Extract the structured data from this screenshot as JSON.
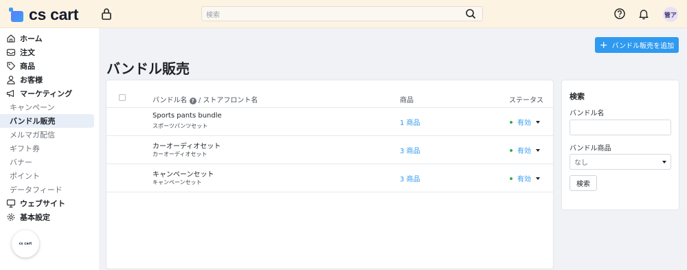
{
  "header": {
    "logo_text": "cs cart",
    "search_placeholder": "検索",
    "avatar_text": "管ア"
  },
  "sidebar": {
    "items": [
      {
        "label": "ホーム",
        "icon": "home-icon",
        "level": "top"
      },
      {
        "label": "注文",
        "icon": "inbox-icon",
        "level": "top"
      },
      {
        "label": "商品",
        "icon": "tag-icon",
        "level": "top"
      },
      {
        "label": "お客様",
        "icon": "user-icon",
        "level": "top"
      },
      {
        "label": "マーケティング",
        "icon": "megaphone-icon",
        "level": "top"
      },
      {
        "label": "キャンペーン",
        "level": "sub"
      },
      {
        "label": "バンドル販売",
        "level": "sub",
        "active": true
      },
      {
        "label": "メルマガ配信",
        "level": "sub"
      },
      {
        "label": "ギフト券",
        "level": "sub"
      },
      {
        "label": "バナー",
        "level": "sub"
      },
      {
        "label": "ポイント",
        "level": "sub"
      },
      {
        "label": "データフィード",
        "level": "sub"
      },
      {
        "label": "ウェブサイト",
        "icon": "monitor-icon",
        "level": "top"
      },
      {
        "label": "基本設定",
        "icon": "gear-icon",
        "level": "top"
      }
    ],
    "promo_text": "cs cart"
  },
  "main": {
    "add_button_label": "バンドル販売を追加",
    "page_title": "バンドル販売",
    "table": {
      "col_name": "バンドル名",
      "col_storefront": "/ ストアフロント名",
      "col_products": "商品",
      "col_status": "ステータス",
      "rows": [
        {
          "name": "Sports pants bundle",
          "storefront": "スポーツパンツセット",
          "products": "1 商品",
          "status": "有効"
        },
        {
          "name": "カーオーディオセット",
          "storefront": "カーオーディオセット",
          "products": "3 商品",
          "status": "有効"
        },
        {
          "name": "キャンペーンセット",
          "storefront": "キャンペーンセット",
          "products": "3 商品",
          "status": "有効"
        }
      ]
    }
  },
  "search_panel": {
    "title": "検索",
    "bundle_name_label": "バンドル名",
    "bundle_name_value": "",
    "bundle_product_label": "バンドル商品",
    "bundle_product_value": "なし",
    "search_button": "検索"
  },
  "colors": {
    "accent": "#2f9af0",
    "header_bg": "#fdf3e3",
    "status_dot": "#34a853"
  }
}
